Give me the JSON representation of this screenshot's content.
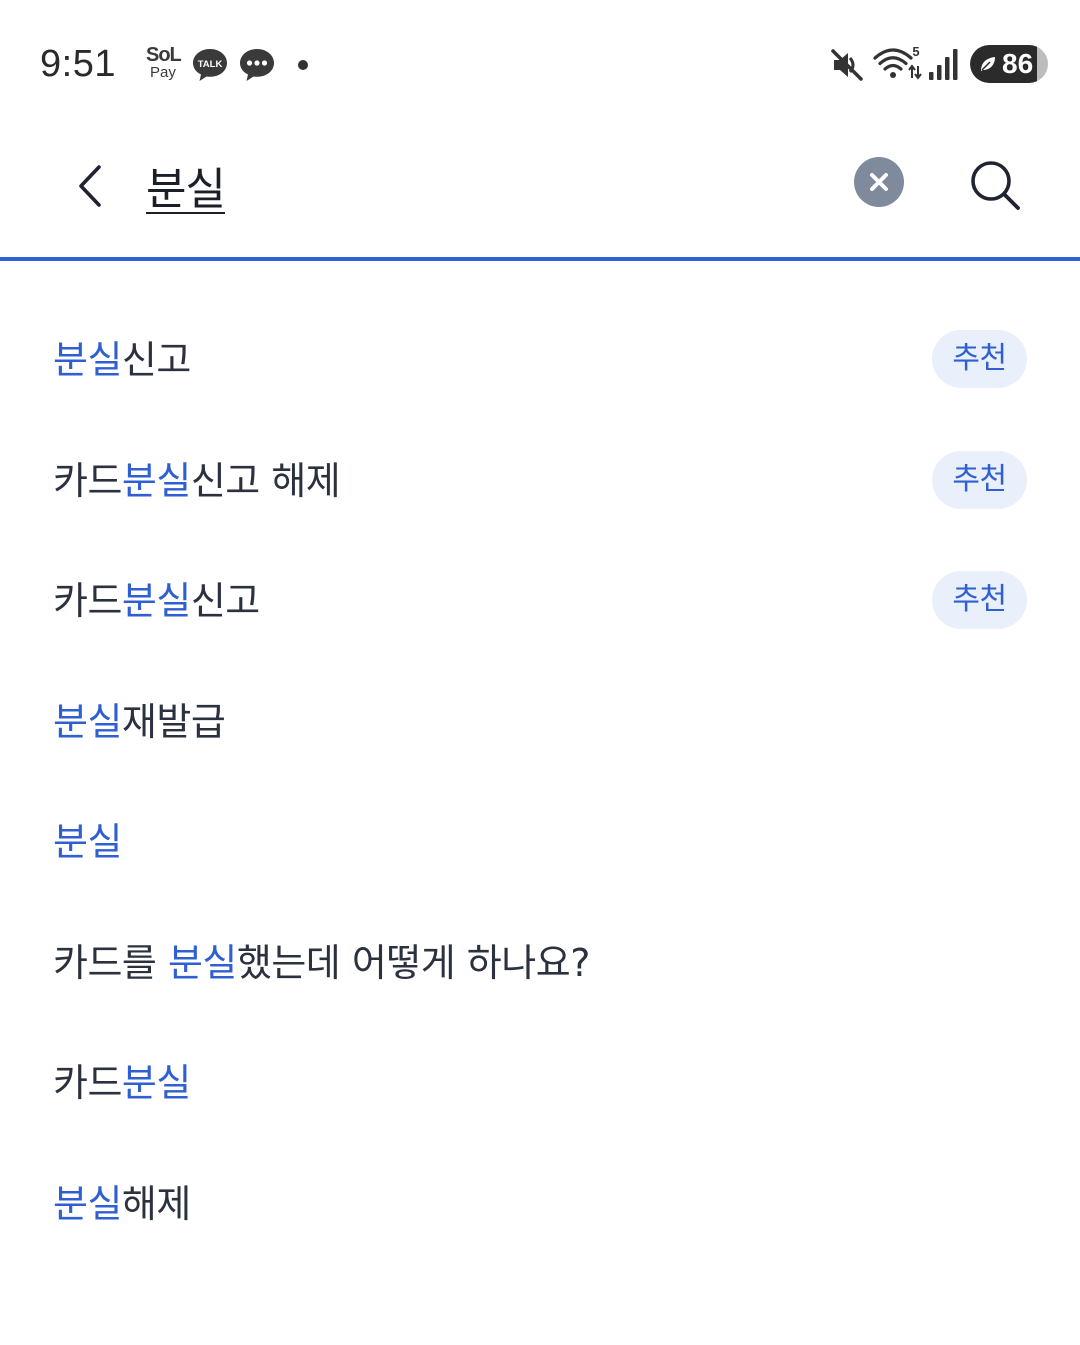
{
  "status_bar": {
    "time": "9:51",
    "sol_top": "SoL",
    "sol_bottom": "Pay",
    "talk_label": "TALK",
    "wifi_badge": "5",
    "battery_level": 86,
    "battery_text": "86",
    "icons": [
      "sol-pay-icon",
      "kakaotalk-icon",
      "chat-bubble-icon",
      "notification-dot",
      "mute-icon",
      "wifi-icon",
      "signal-icon",
      "battery-icon"
    ]
  },
  "search": {
    "query": "분실",
    "accent_color": "#2f62d6",
    "icons": [
      "back-chevron-icon",
      "clear-icon",
      "search-icon"
    ]
  },
  "suggestions": [
    {
      "parts": [
        {
          "t": "분실",
          "hl": true
        },
        {
          "t": "신고",
          "hl": false
        }
      ],
      "badge": "추천"
    },
    {
      "parts": [
        {
          "t": "카드",
          "hl": false
        },
        {
          "t": "분실",
          "hl": true
        },
        {
          "t": "신고 해제",
          "hl": false
        }
      ],
      "badge": "추천"
    },
    {
      "parts": [
        {
          "t": "카드",
          "hl": false
        },
        {
          "t": "분실",
          "hl": true
        },
        {
          "t": "신고",
          "hl": false
        }
      ],
      "badge": "추천"
    },
    {
      "parts": [
        {
          "t": "분실",
          "hl": true
        },
        {
          "t": "재발급",
          "hl": false
        }
      ],
      "badge": ""
    },
    {
      "parts": [
        {
          "t": "분실",
          "hl": true
        }
      ],
      "badge": ""
    },
    {
      "parts": [
        {
          "t": "카드를 ",
          "hl": false
        },
        {
          "t": "분실",
          "hl": true
        },
        {
          "t": "했는데 어떻게 하나요?",
          "hl": false
        }
      ],
      "badge": ""
    },
    {
      "parts": [
        {
          "t": "카드",
          "hl": false
        },
        {
          "t": "분실",
          "hl": true
        }
      ],
      "badge": ""
    },
    {
      "parts": [
        {
          "t": "분실",
          "hl": true
        },
        {
          "t": "해제",
          "hl": false
        }
      ],
      "badge": ""
    }
  ],
  "colors": {
    "highlight": "#2f5fd0",
    "badge_bg": "#e9effb",
    "text": "#2c3140"
  }
}
